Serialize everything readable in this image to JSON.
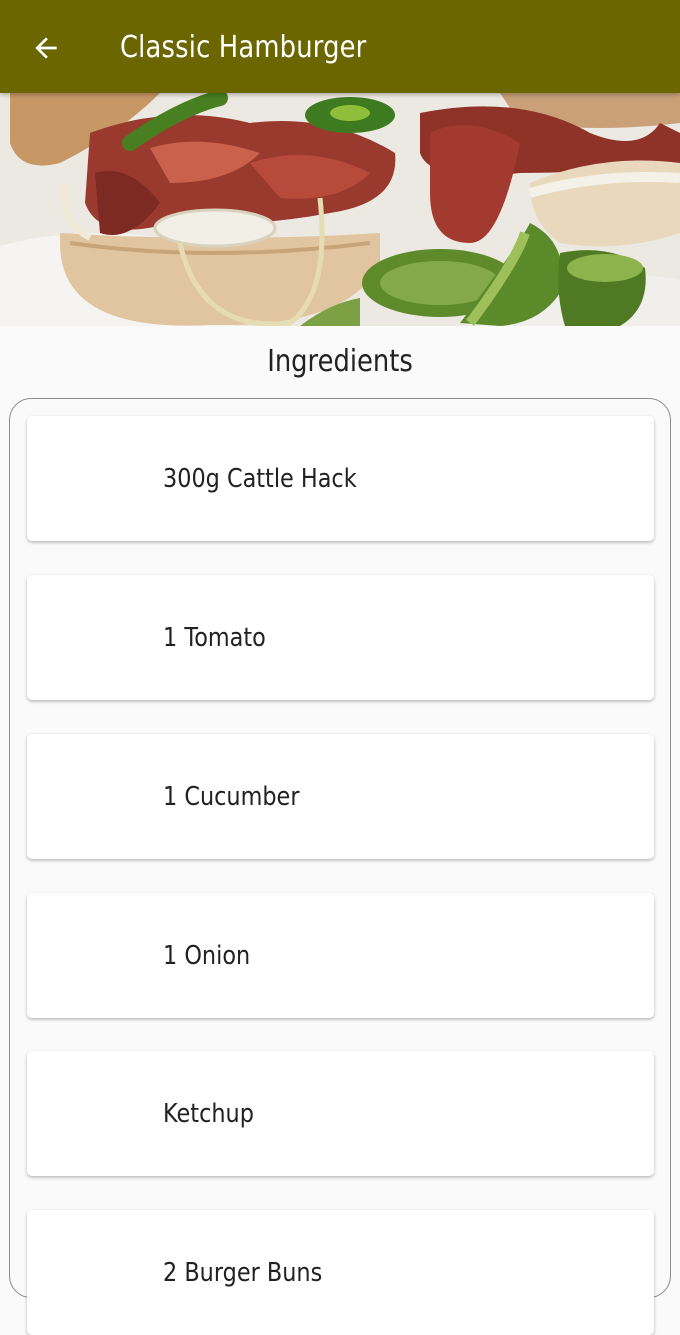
{
  "appbar": {
    "title": "Classic Hamburger",
    "back_icon": "arrow-left-icon",
    "background_color": "#6b6600"
  },
  "hero": {
    "image": "hamburger-photo"
  },
  "ingredients": {
    "title": "Ingredients",
    "items": [
      {
        "label": "300g Cattle Hack"
      },
      {
        "label": "1 Tomato"
      },
      {
        "label": "1 Cucumber"
      },
      {
        "label": "1 Onion"
      },
      {
        "label": "Ketchup"
      },
      {
        "label": "2 Burger Buns"
      }
    ]
  }
}
